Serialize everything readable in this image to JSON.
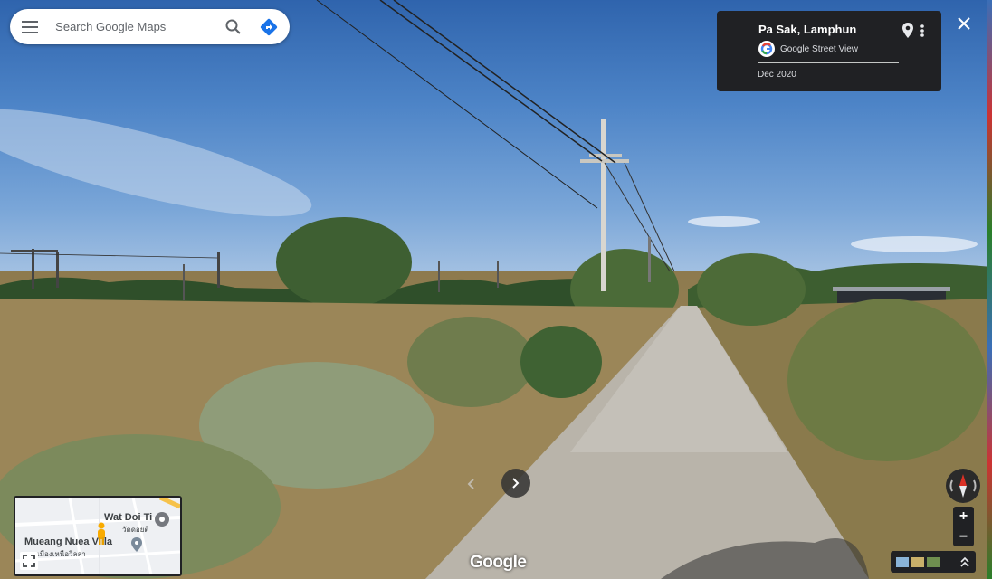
{
  "search": {
    "placeholder": "Search Google Maps"
  },
  "info_card": {
    "place_name": "Pa Sak, Lamphun",
    "source_label": "Google Street View",
    "capture_date": "Dec 2020"
  },
  "minimap": {
    "place1": "Wat Doi Ti",
    "place1_local": "วัดดอยตี",
    "place2": "Mueang Nuea Villa",
    "place2_local": "เมืองเหนือวิลล่า"
  },
  "zoom": {
    "in_label": "+",
    "out_label": "−"
  },
  "watermark": "Google",
  "icons": [
    "menu-icon",
    "search-icon",
    "directions-icon",
    "pin-icon",
    "more-vert-icon",
    "close-icon",
    "chevron-left-icon",
    "chevron-right-icon",
    "expand-icon",
    "compass-icon",
    "chevron-up-icon",
    "google-g-icon",
    "pegman-icon"
  ],
  "colors": {
    "directions_blue": "#1a73e8",
    "card_bg": "#202124",
    "compass_red": "#d93025"
  }
}
